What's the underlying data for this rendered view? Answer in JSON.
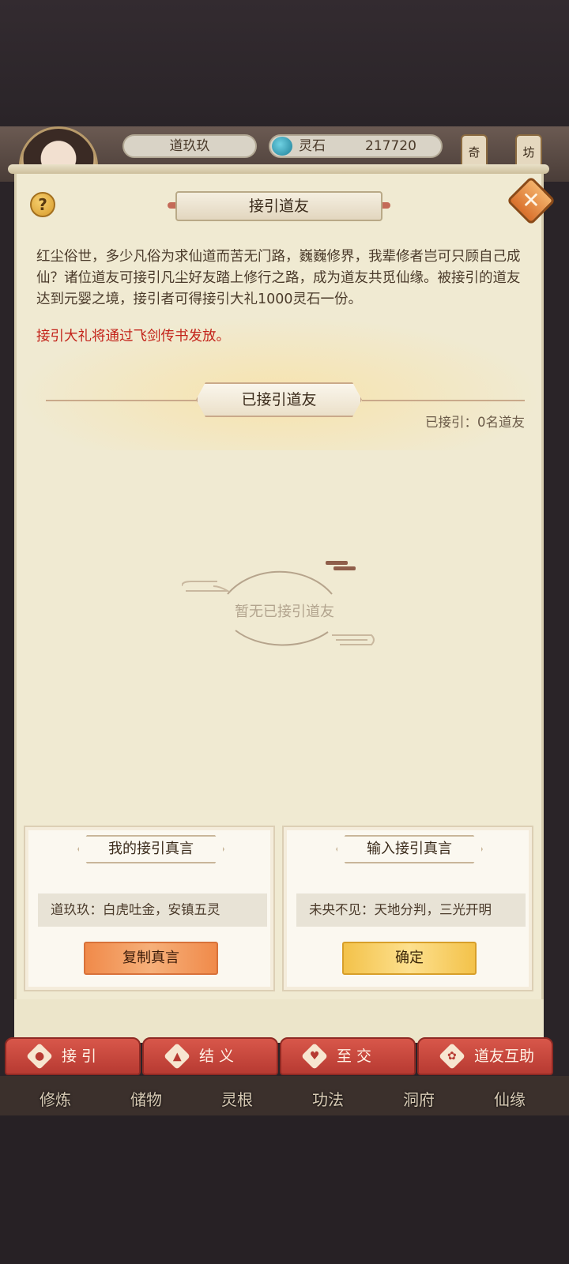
{
  "header": {
    "player_name": "道玖玖",
    "stone_label": "灵石",
    "stone_value": "217720",
    "side_buttons": [
      "奇",
      "坊"
    ]
  },
  "dialog": {
    "help_label": "?",
    "close_label": "✕",
    "title": "接引道友",
    "description": "红尘俗世，多少凡俗为求仙道而苦无门路，巍巍修界，我辈修者岂可只顾自己成仙？诸位道友可接引凡尘好友踏上修行之路，成为道友共觅仙缘。被接引的道友达到元婴之境，接引者可得接引大礼1000灵石一份。",
    "notice": "接引大礼将通过飞剑传书发放。",
    "section_title": "已接引道友",
    "count": "已接引：0名道友",
    "empty_text": "暂无已接引道友"
  },
  "cards": {
    "mine": {
      "title": "我的接引真言",
      "value": "道玖玖：白虎吐金，安镇五灵",
      "button": "复制真言"
    },
    "input": {
      "title": "输入接引真言",
      "value": "未央不见：天地分判，三光开明",
      "button": "确定"
    }
  },
  "tabs": [
    {
      "label": "接 引",
      "icon": "person-icon"
    },
    {
      "label": "结 义",
      "icon": "people-icon"
    },
    {
      "label": "至 交",
      "icon": "heart-icon"
    },
    {
      "label": "道友互助",
      "icon": "help-icon"
    }
  ],
  "bottom_nav": [
    "修炼",
    "储物",
    "灵根",
    "功法",
    "洞府",
    "仙缘"
  ],
  "colors": {
    "notice_red": "#c3231a",
    "tab_red": "#b73a32",
    "panel_bg": "#f0ead2"
  }
}
